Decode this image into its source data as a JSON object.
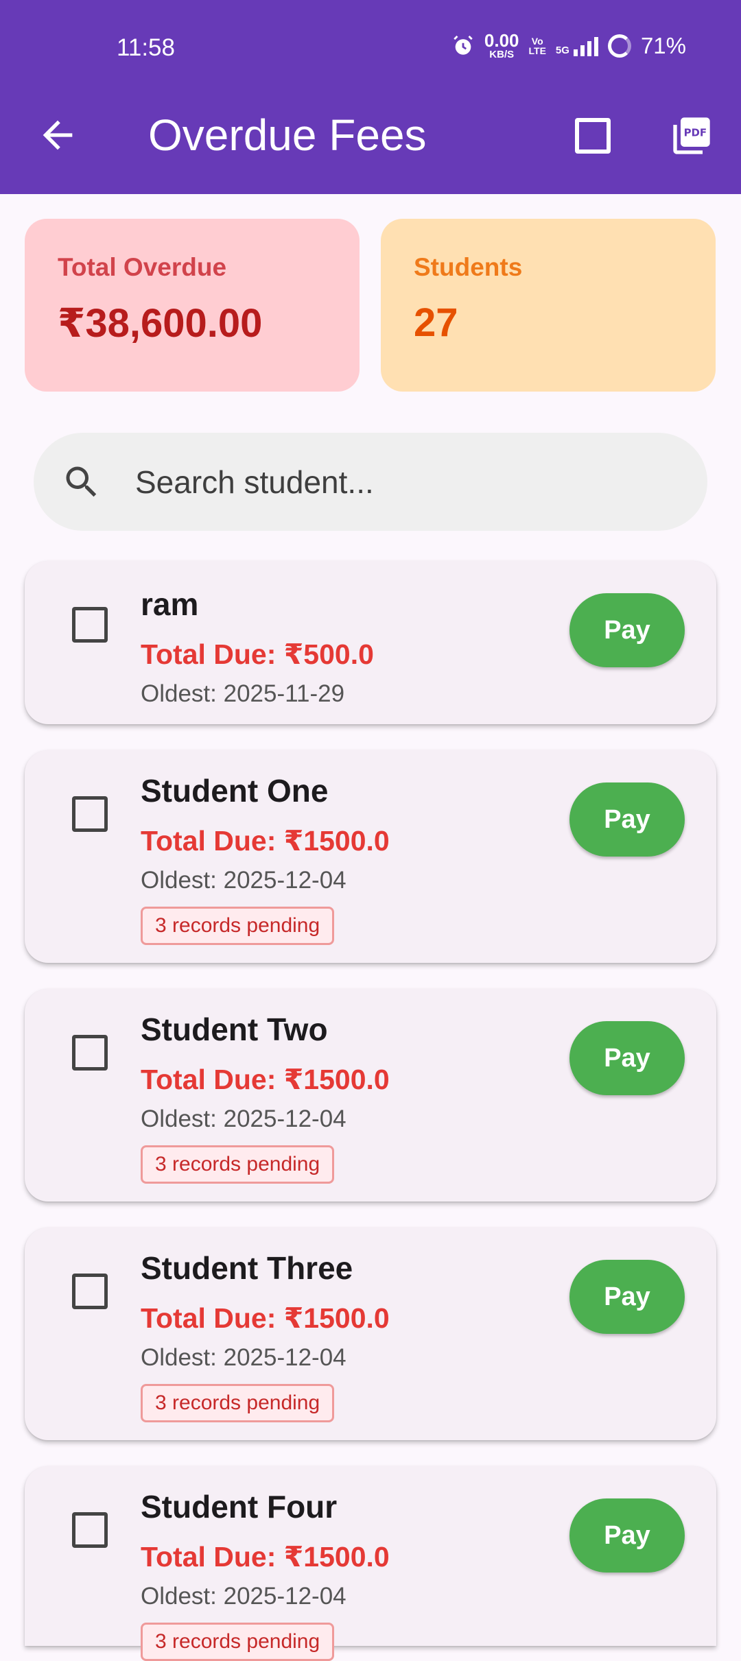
{
  "status_bar": {
    "time": "11:58",
    "net_speed": "0.00",
    "net_unit": "KB/S",
    "volte": "Vo\nLTE",
    "network": "5G",
    "battery": "71%"
  },
  "appbar": {
    "title": "Overdue Fees",
    "color": "#673ab7"
  },
  "summary": {
    "total_overdue_label": "Total Overdue",
    "total_overdue_value": "₹38,600.00",
    "students_label": "Students",
    "students_value": "27"
  },
  "search": {
    "placeholder": "Search student..."
  },
  "students": [
    {
      "name": "ram",
      "total_due": "Total Due: ₹500.0",
      "oldest": "Oldest: 2025-11-29",
      "badge": "",
      "pay_label": "Pay"
    },
    {
      "name": "Student One",
      "total_due": "Total Due: ₹1500.0",
      "oldest": "Oldest: 2025-12-04",
      "badge": "3 records pending",
      "pay_label": "Pay"
    },
    {
      "name": "Student Two",
      "total_due": "Total Due: ₹1500.0",
      "oldest": "Oldest: 2025-12-04",
      "badge": "3 records pending",
      "pay_label": "Pay"
    },
    {
      "name": "Student Three",
      "total_due": "Total Due: ₹1500.0",
      "oldest": "Oldest: 2025-12-04",
      "badge": "3 records pending",
      "pay_label": "Pay"
    },
    {
      "name": "Student Four",
      "total_due": "Total Due: ₹1500.0",
      "oldest": "Oldest: 2025-12-04",
      "badge": "3 records pending",
      "pay_label": "Pay"
    }
  ]
}
